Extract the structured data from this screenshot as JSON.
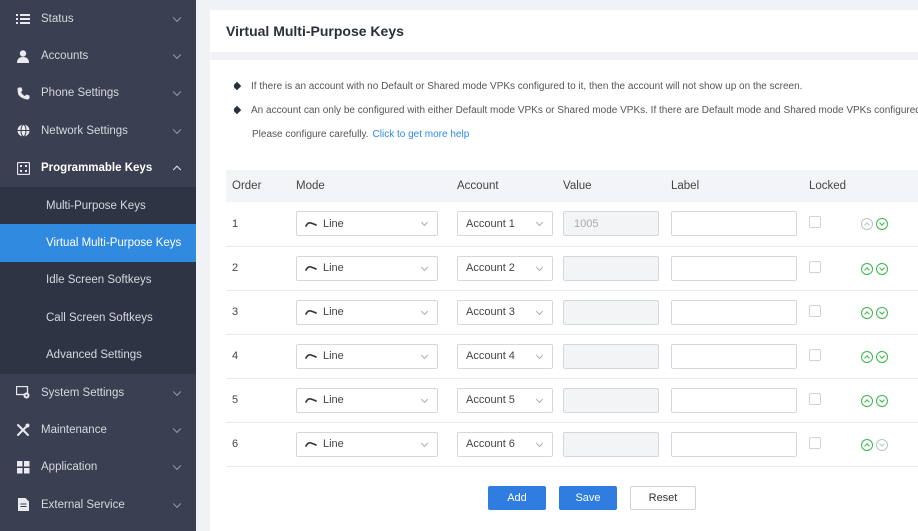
{
  "sidebar": {
    "items": [
      {
        "label": "Status",
        "icon": "list-icon"
      },
      {
        "label": "Accounts",
        "icon": "user-icon"
      },
      {
        "label": "Phone Settings",
        "icon": "phone-icon"
      },
      {
        "label": "Network Settings",
        "icon": "globe-icon"
      },
      {
        "label": "Programmable Keys",
        "icon": "keypad-icon",
        "open": true
      },
      {
        "label": "System Settings",
        "icon": "system-icon"
      },
      {
        "label": "Maintenance",
        "icon": "tools-icon"
      },
      {
        "label": "Application",
        "icon": "apps-icon"
      },
      {
        "label": "External Service",
        "icon": "document-icon"
      }
    ],
    "sub_items": [
      {
        "label": "Multi-Purpose Keys"
      },
      {
        "label": "Virtual Multi-Purpose Keys",
        "active": true
      },
      {
        "label": "Idle Screen Softkeys"
      },
      {
        "label": "Call Screen Softkeys"
      },
      {
        "label": "Advanced Settings"
      }
    ]
  },
  "page": {
    "title": "Virtual Multi-Purpose Keys",
    "notes": [
      "If there is an account with no Default or Shared mode VPKs configured to it, then the account will not show up on the screen.",
      "An account can only be configured with either Default mode VPKs or Shared mode VPKs. If there are Default mode and Shared mode VPKs configured"
    ],
    "note_tail": "Please configure carefully.",
    "help_link": "Click to get more help"
  },
  "table": {
    "headers": {
      "order": "Order",
      "mode": "Mode",
      "account": "Account",
      "value": "Value",
      "label": "Label",
      "locked": "Locked"
    },
    "rows": [
      {
        "order": "1",
        "mode": "Line",
        "account": "Account 1",
        "value": "1005",
        "label": "",
        "locked": false,
        "up_enabled": false,
        "down_enabled": true
      },
      {
        "order": "2",
        "mode": "Line",
        "account": "Account 2",
        "value": "",
        "label": "",
        "locked": false,
        "up_enabled": true,
        "down_enabled": true
      },
      {
        "order": "3",
        "mode": "Line",
        "account": "Account 3",
        "value": "",
        "label": "",
        "locked": false,
        "up_enabled": true,
        "down_enabled": true
      },
      {
        "order": "4",
        "mode": "Line",
        "account": "Account 4",
        "value": "",
        "label": "",
        "locked": false,
        "up_enabled": true,
        "down_enabled": true
      },
      {
        "order": "5",
        "mode": "Line",
        "account": "Account 5",
        "value": "",
        "label": "",
        "locked": false,
        "up_enabled": true,
        "down_enabled": true
      },
      {
        "order": "6",
        "mode": "Line",
        "account": "Account 6",
        "value": "",
        "label": "",
        "locked": false,
        "up_enabled": true,
        "down_enabled": false
      }
    ]
  },
  "buttons": {
    "add": "Add",
    "save": "Save",
    "reset": "Reset"
  },
  "colors": {
    "sidebar_bg": "#3a3f51",
    "active_item": "#2f8ae0",
    "primary": "#2f7de0",
    "arrow_green": "#3cb64a"
  }
}
